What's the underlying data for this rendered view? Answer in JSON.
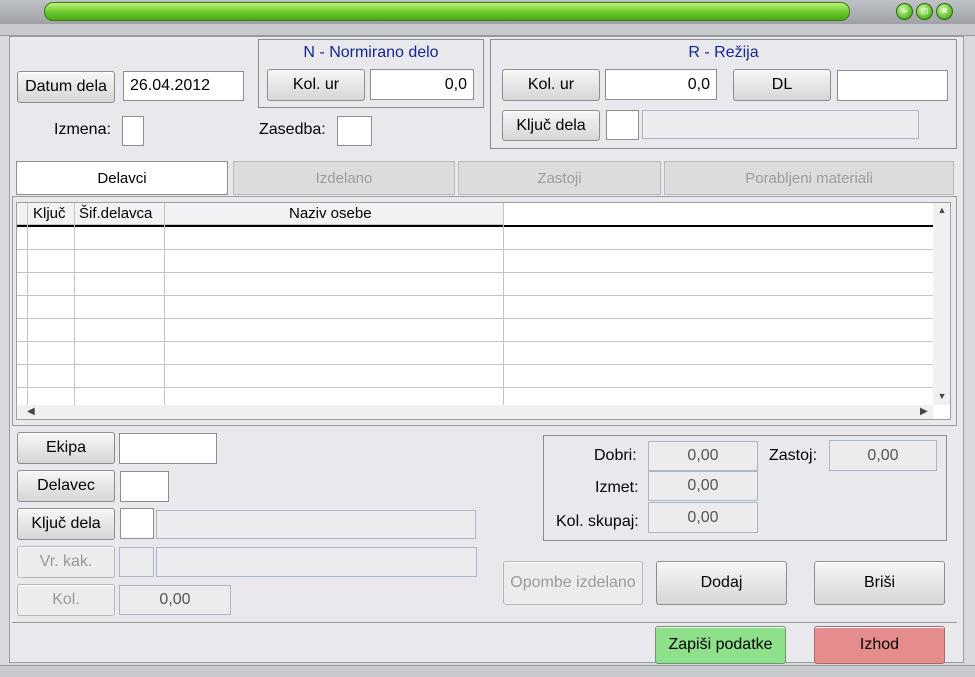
{
  "window": {
    "minimize_icon": "minimize-icon",
    "maximize_icon": "maximize-icon",
    "close_icon": "close-icon"
  },
  "header": {
    "datum_dela_label": "Datum dela",
    "datum_dela_value": "26.04.2012",
    "izmena_label": "Izmena:",
    "izmena_value": "",
    "zasedba_label": "Zasedba:",
    "zasedba_value": ""
  },
  "normirano": {
    "title": "N - Normirano delo",
    "kol_ur_label": "Kol. ur",
    "kol_ur_value": "0,0"
  },
  "rezija": {
    "title": "R - Režija",
    "kol_ur_label": "Kol. ur",
    "kol_ur_value": "0,0",
    "dl_label": "DL",
    "dl_value": "",
    "kljuc_dela_label": "Ključ dela",
    "kljuc_dela_code": "",
    "kljuc_dela_desc": ""
  },
  "tabs": [
    {
      "label": "Delavci",
      "active": true
    },
    {
      "label": "Izdelano",
      "active": false
    },
    {
      "label": "Zastoji",
      "active": false
    },
    {
      "label": "Porabljeni materiali",
      "active": false
    }
  ],
  "grid": {
    "columns": [
      "Ključ",
      "Šif.delavca",
      "Naziv osebe"
    ],
    "rows": []
  },
  "bottom": {
    "ekipa_label": "Ekipa",
    "ekipa_value": "",
    "delavec_label": "Delavec",
    "delavec_value": "",
    "kljuc_dela_label": "Ključ dela",
    "kljuc_dela_code": "",
    "kljuc_dela_desc": "",
    "vr_kak_label": "Vr. kak.",
    "kol_label": "Kol.",
    "kol_value": "0,00"
  },
  "summary": {
    "dobri_label": "Dobri:",
    "dobri_value": "0,00",
    "zastoj_label": "Zastoj:",
    "zastoj_value": "0,00",
    "izmet_label": "Izmet:",
    "izmet_value": "0,00",
    "kol_skupaj_label": "Kol. skupaj:",
    "kol_skupaj_value": "0,00"
  },
  "actions": {
    "opombe_label": "Opombe izdelano",
    "dodaj_label": "Dodaj",
    "brisi_label": "Briši",
    "zapisi_label": "Zapiši podatke",
    "izhod_label": "Izhod"
  },
  "colors": {
    "zapisi_bg": "#8fe08a",
    "izhod_bg": "#e58c8c",
    "title_green": "#68c82a",
    "group_title": "#12288f"
  }
}
